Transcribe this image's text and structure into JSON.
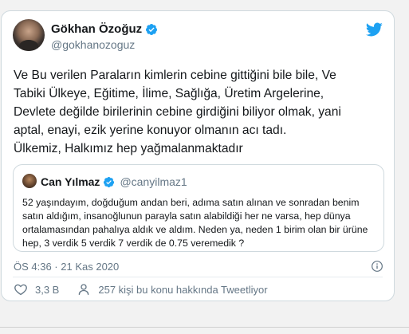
{
  "author": {
    "name": "Gökhan Özoğuz",
    "handle": "@gokhanozoguz",
    "verified_icon": "verified-badge-icon",
    "avatar": "avatar"
  },
  "tweet": {
    "text": "Ve Bu verilen Paraların kimlerin cebine gittiğini bile bile,  Ve\nTabiki Ülkeye, Eğitime, İlime, Sağlığa, Üretim Argelerine,\nDevlete değilde birilerinin cebine girdiğini biliyor olmak, yani\naptal, enayi, ezik yerine konuyor olmanın acı tadı.\nÜlkemiz, Halkımız hep yağmalanmaktadır"
  },
  "quote": {
    "name": "Can Yılmaz",
    "handle": "@canyilmaz1",
    "text": "52 yaşındayım, doğduğum andan beri, adıma satın alınan ve sonradan benim satın aldığım, insanoğlunun parayla satın alabildiği her ne varsa, hep dünya ortalamasından pahalıya aldık ve aldım. Neden ya, neden 1 birim olan bir ürüne hep, 3 verdik 5 verdik 7 verdik de 0.75 veremedik ?"
  },
  "meta": {
    "timestamp": "ÖS 4:36 · 21 Kas 2020"
  },
  "actions": {
    "likes": "3,3 B",
    "conversation": "257 kişi bu konu hakkında Tweetliyor"
  },
  "colors": {
    "brand": "#1da1f2",
    "secondary_text": "#657786",
    "border": "#cfd9de"
  }
}
